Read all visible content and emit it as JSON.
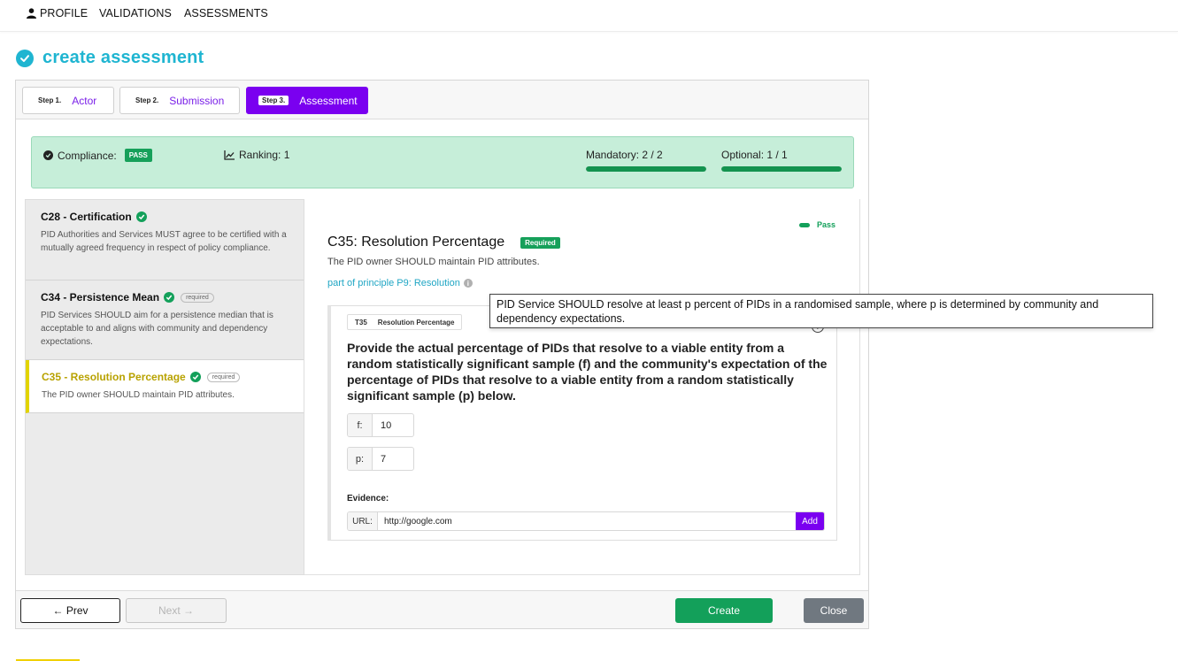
{
  "nav": {
    "profile": "PROFILE",
    "validations": "VALIDATIONS",
    "assessments": "ASSESSMENTS"
  },
  "page": {
    "title": "create assessment"
  },
  "steps": [
    {
      "num": "Step 1.",
      "label": "Actor",
      "active": false
    },
    {
      "num": "Step 2.",
      "label": "Submission",
      "active": false
    },
    {
      "num": "Step 3.",
      "label": "Assessment",
      "active": true
    }
  ],
  "banner": {
    "compliance_label": "Compliance:",
    "compliance_badge": "PASS",
    "ranking": "Ranking: 1",
    "mandatory_label": "Mandatory: 2 / 2",
    "mandatory_fraction": 1.0,
    "optional_label": "Optional: 1 / 1",
    "optional_fraction": 1.0
  },
  "criteria": [
    {
      "title": "C28 - Certification",
      "required_tag": "",
      "desc": "PID Authorities and Services MUST agree to be certified with a mutually agreed frequency in respect of policy compliance."
    },
    {
      "title": "C34 - Persistence Mean",
      "required_tag": "required",
      "desc": "PID Services SHOULD aim for a persistence median that is acceptable to and aligns with community and dependency expectations."
    },
    {
      "title": "C35 - Resolution Percentage",
      "required_tag": "required",
      "desc": "The PID owner SHOULD maintain PID attributes."
    }
  ],
  "detail": {
    "pass_label": "Pass",
    "heading": "C35: Resolution Percentage",
    "required_badge": "Required",
    "subtitle": "The PID owner SHOULD maintain PID attributes.",
    "principle_link": "part of principle P9: Resolution",
    "info_glyph": "i",
    "metric_id": "T35",
    "metric_name": "Resolution Percentage",
    "question": "Provide the actual percentage of PIDs that resolve to a viable entity from a random statistically significant sample (f) and the community's expectation of the percentage of PIDs that resolve to a viable entity from a random statistically significant sample (p) below.",
    "params": [
      {
        "label": "f:",
        "value": "10"
      },
      {
        "label": "p:",
        "value": "7"
      }
    ],
    "evidence_label": "Evidence:",
    "url_label": "URL:",
    "url_value": "http://google.com",
    "add_label": "Add"
  },
  "tooltip": {
    "text": "PID Service SHOULD resolve at least p percent of PIDs in a randomised sample, where p is determined by community and dependency expectations."
  },
  "footer": {
    "prev": "← Prev",
    "next": "Next →",
    "create": "Create",
    "close": "Close"
  },
  "colors": {
    "accent": "#1fb5d1",
    "purple": "#7a00f0",
    "green": "#13a05a",
    "banner_bg": "#c6eed9",
    "highlight": "#e2d400"
  }
}
